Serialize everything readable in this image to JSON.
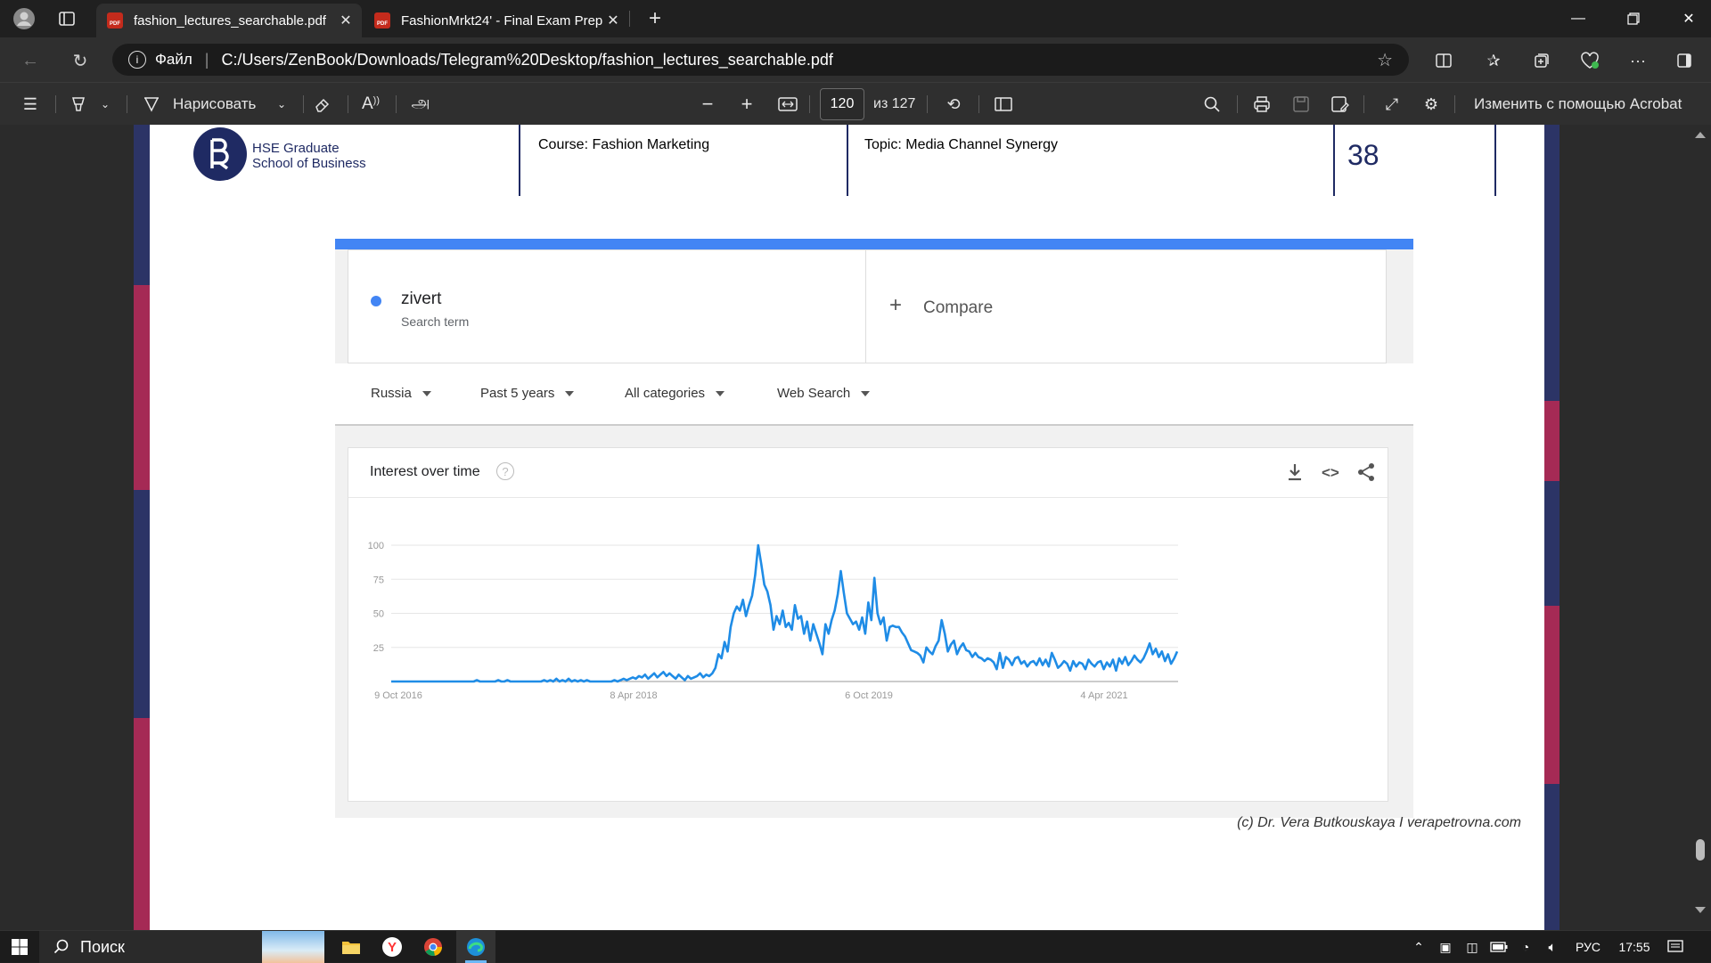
{
  "browser": {
    "tabs": [
      {
        "title": "fashion_lectures_searchable.pdf",
        "icon": "pdf-icon",
        "active": true
      },
      {
        "title": "FashionMrkt24' - Final Exam Prep",
        "icon": "pdf-icon",
        "active": false
      }
    ],
    "address": {
      "scheme_label": "Файл",
      "url": "C:/Users/ZenBook/Downloads/Telegram%20Desktop/fashion_lectures_searchable.pdf"
    }
  },
  "pdf_toolbar": {
    "draw_label": "Нарисовать",
    "read_aloud": "A",
    "translate_icon": "அ",
    "page_current": "120",
    "page_total": "из 127",
    "edit_acrobat": "Изменить с помощью Acrobat"
  },
  "slide": {
    "school_line1": "HSE Graduate",
    "school_line2": "School of Business",
    "course": "Course: Fashion Marketing",
    "topic": "Topic: Media Channel Synergy",
    "slide_number": "38",
    "credit": "(c) Dr. Vera Butkouskaya I verapetrovna.com",
    "trends": {
      "term": "zivert",
      "term_sub": "Search term",
      "compare": "Compare",
      "filters": [
        "Russia",
        "Past 5 years",
        "All categories",
        "Web Search"
      ],
      "card_title": "Interest over time",
      "accent": "#4285f4",
      "line_color": "#1f8ce6"
    }
  },
  "chart_data": {
    "type": "line",
    "title": "Interest over time",
    "series": [
      {
        "name": "zivert",
        "values": [
          0,
          0,
          0,
          0,
          0,
          0,
          0,
          0,
          0,
          0,
          0,
          0,
          0,
          0,
          0,
          0,
          0,
          0,
          0,
          0,
          0,
          0,
          0,
          0,
          0,
          0,
          0,
          0,
          1,
          0,
          0,
          0,
          0,
          0,
          0,
          1,
          0,
          0,
          1,
          0,
          0,
          0,
          0,
          0,
          0,
          0,
          0,
          0,
          0,
          0,
          1,
          0,
          1,
          0,
          2,
          0,
          1,
          0,
          2,
          0,
          1,
          0,
          1,
          0,
          1,
          0,
          0,
          0,
          0,
          0,
          0,
          0,
          0,
          1,
          0,
          1,
          2,
          1,
          2,
          3,
          2,
          4,
          3,
          5,
          2,
          4,
          6,
          3,
          5,
          7,
          4,
          6,
          4,
          2,
          5,
          3,
          1,
          4,
          2,
          3,
          4,
          6,
          3,
          5,
          4,
          6,
          10,
          20,
          17,
          29,
          22,
          40,
          50,
          55,
          52,
          60,
          48,
          56,
          63,
          78,
          100,
          86,
          71,
          66,
          56,
          38,
          48,
          42,
          52,
          40,
          43,
          38,
          56,
          46,
          48,
          35,
          44,
          30,
          42,
          35,
          28,
          20,
          42,
          35,
          45,
          52,
          64,
          81,
          65,
          50,
          46,
          42,
          44,
          38,
          47,
          35,
          58,
          45,
          76,
          50,
          42,
          47,
          30,
          40,
          41,
          40,
          40,
          36,
          33,
          28,
          23,
          22,
          21,
          19,
          14,
          25,
          22,
          20,
          26,
          30,
          45,
          35,
          22,
          27,
          30,
          20,
          25,
          28,
          23,
          22,
          18,
          21,
          18,
          17,
          15,
          17,
          16,
          14,
          9,
          21,
          10,
          18,
          16,
          12,
          17,
          18,
          13,
          15,
          11,
          14,
          15,
          12,
          17,
          12,
          16,
          11,
          21,
          16,
          10,
          12,
          15,
          13,
          8,
          15,
          11,
          14,
          13,
          9,
          16,
          13,
          11,
          14,
          15,
          9,
          14,
          11,
          16,
          8,
          17,
          13,
          18,
          12,
          15,
          19,
          16,
          14,
          17,
          22,
          28,
          20,
          24,
          18,
          22,
          15,
          20,
          13,
          17,
          22
        ]
      }
    ],
    "x_ticks": [
      "9 Oct 2016",
      "8 Apr 2018",
      "6 Oct 2019",
      "4 Apr 2021"
    ],
    "y_ticks": [
      100,
      75,
      50,
      25
    ],
    "ylim": [
      0,
      100
    ]
  },
  "taskbar": {
    "search": "Поиск",
    "lang": "РУС",
    "time": "17:55"
  }
}
